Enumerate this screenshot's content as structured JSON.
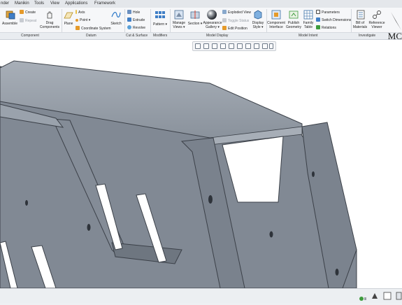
{
  "menu": {
    "tabs": [
      "nder",
      "Manikin",
      "Tools",
      "View",
      "Applications",
      "Framework"
    ]
  },
  "ribbon": {
    "groups": {
      "component": "Component",
      "datum": "Datum",
      "cut_surface": "Cut & Surface",
      "modifiers": "Modifiers",
      "model_display": "Model Display",
      "model_intent": "Model Intent",
      "investigate": "Investigate"
    },
    "commands": {
      "assemble": "Assemble",
      "create": "Create",
      "repeat": "Repeat",
      "drag_components": [
        "Drag",
        "Components"
      ],
      "plane": "Plane",
      "axis": "Axis",
      "point": "Point",
      "coordinate_system": "Coordinate System",
      "sketch": "Sketch",
      "hole": "Hole",
      "extrude": "Extrude",
      "revolve": "Revolve",
      "pattern": "Pattern",
      "manage_views": [
        "Manage",
        "Views"
      ],
      "section": "Section",
      "appearance_gallery": [
        "Appearance",
        "Gallery"
      ],
      "exploded_view": "Exploded View",
      "toggle_status": "Toggle Status",
      "edit_position": "Edit Position",
      "display_style": [
        "Display",
        "Style"
      ],
      "component_interface": [
        "Component",
        "Interface"
      ],
      "publish_geometry": [
        "Publish",
        "Geometry"
      ],
      "family_table": [
        "Family",
        "Table"
      ],
      "parameters": "Parameters",
      "switch_dimensions": "Switch Dimensions",
      "relations": "Relations",
      "bill_of_materials": [
        "Bill of",
        "Materials"
      ],
      "reference_viewer": [
        "Reference",
        "Viewer"
      ]
    }
  },
  "logo_text": "MC",
  "colors": {
    "part_face": "#7d8590",
    "part_top": "#9aa2ac",
    "part_edge": "#3b4048",
    "accent_blue": "#2c78c8",
    "accent_orange": "#e59a2a",
    "accent_green": "#3d9b3d"
  }
}
